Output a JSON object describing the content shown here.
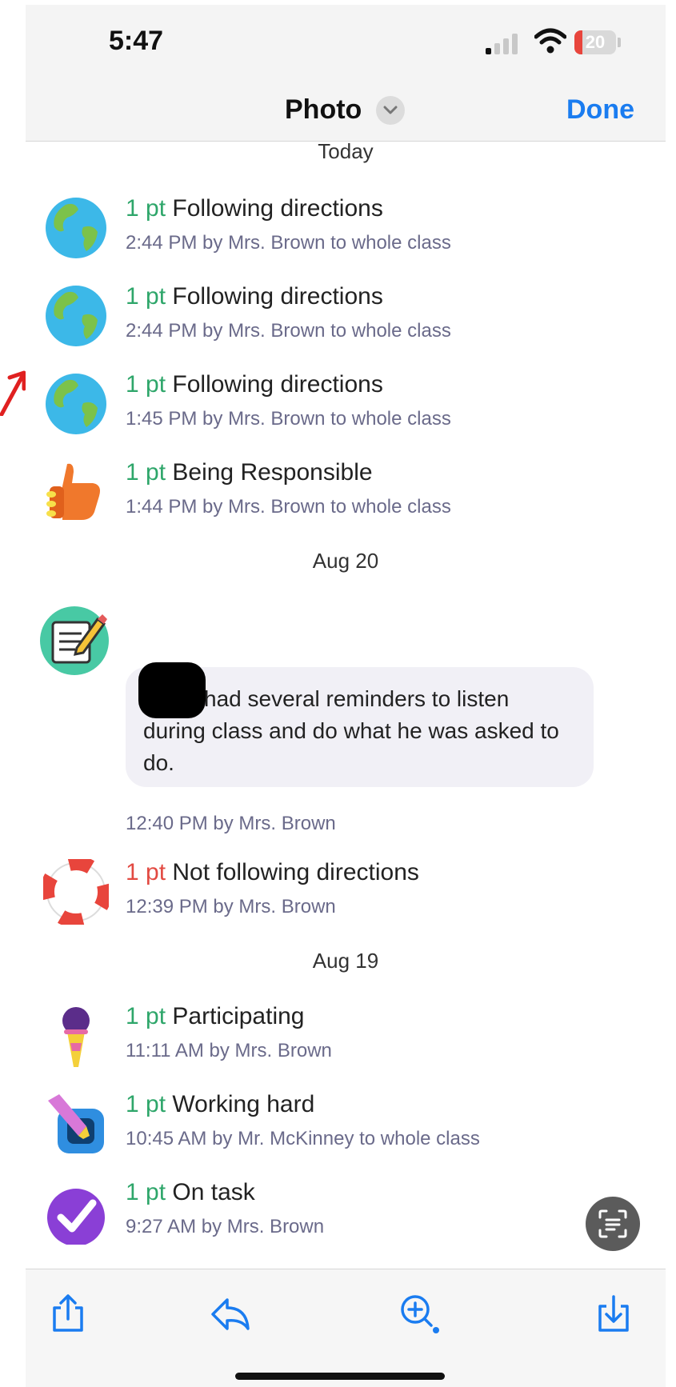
{
  "status_bar": {
    "time": "5:47",
    "battery": "20"
  },
  "nav": {
    "title": "Photo",
    "done_label": "Done"
  },
  "sections": [
    {
      "date": "Today",
      "items": [
        {
          "points": "1 pt",
          "behavior": "Following directions",
          "meta": "2:44 PM by Mrs. Brown to whole class",
          "icon": "globe-icon"
        },
        {
          "points": "1 pt",
          "behavior": "Following directions",
          "meta": "2:44 PM by Mrs. Brown to whole class",
          "icon": "globe-icon"
        },
        {
          "points": "1 pt",
          "behavior": "Following directions",
          "meta": "1:45 PM by Mrs. Brown to whole class",
          "icon": "globe-icon"
        },
        {
          "points": "1 pt",
          "behavior": "Being Responsible",
          "meta": "1:44 PM by Mrs. Brown to whole class",
          "icon": "thumbs-up-icon"
        }
      ]
    },
    {
      "date": "Aug 20",
      "note": {
        "text": "had several reminders to listen during class and do what he was asked to do.",
        "meta": "12:40 PM by Mrs. Brown",
        "icon": "note-pencil-icon"
      },
      "items": [
        {
          "points": "1 pt",
          "behavior": "Not following directions",
          "meta": "12:39 PM by Mrs. Brown",
          "icon": "life-ring-icon"
        }
      ]
    },
    {
      "date": "Aug 19",
      "items": [
        {
          "points": "1 pt",
          "behavior": "Participating",
          "meta": "11:11 AM by Mrs. Brown",
          "icon": "microphone-icon"
        },
        {
          "points": "1 pt",
          "behavior": "Working hard",
          "meta": "10:45 AM by Mr. McKinney to whole class",
          "icon": "highlighter-icon"
        },
        {
          "points": "1 pt",
          "behavior": "On task",
          "meta": "9:27 AM by Mrs. Brown",
          "icon": "checkmark-icon"
        }
      ]
    }
  ],
  "colors": {
    "accent_blue": "#1a7cf0",
    "positive_green": "#2ea66a",
    "negative_red": "#e24a42",
    "meta_text": "#6a6a8a"
  },
  "toolbar": [
    "share-icon",
    "reply-icon",
    "zoom-in-icon",
    "save-download-icon"
  ]
}
